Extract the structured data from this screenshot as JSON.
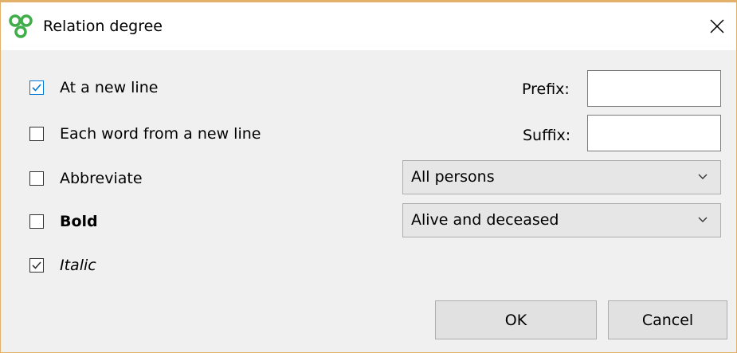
{
  "window": {
    "title": "Relation degree",
    "app_icon": "genealogy-app-icon",
    "close_icon": "close-icon"
  },
  "options": {
    "new_line": {
      "label": "At a new line",
      "checked": true
    },
    "each_word": {
      "label": "Each word from a new line",
      "checked": false
    },
    "abbreviate": {
      "label": "Abbreviate",
      "checked": false
    },
    "bold": {
      "label": "Bold",
      "checked": false
    },
    "italic": {
      "label": "Italic",
      "checked": true
    }
  },
  "prefix": {
    "label": "Prefix:",
    "value": ""
  },
  "suffix": {
    "label": "Suffix:",
    "value": ""
  },
  "persons_select": {
    "value": "All persons",
    "icon": "chevron-down-icon"
  },
  "status_select": {
    "value": "Alive and deceased",
    "icon": "chevron-down-icon"
  },
  "buttons": {
    "ok": "OK",
    "cancel": "Cancel"
  },
  "colors": {
    "accent": "#0078d7",
    "app_icon": "#3fae49",
    "window_border": "#e3b06a"
  }
}
